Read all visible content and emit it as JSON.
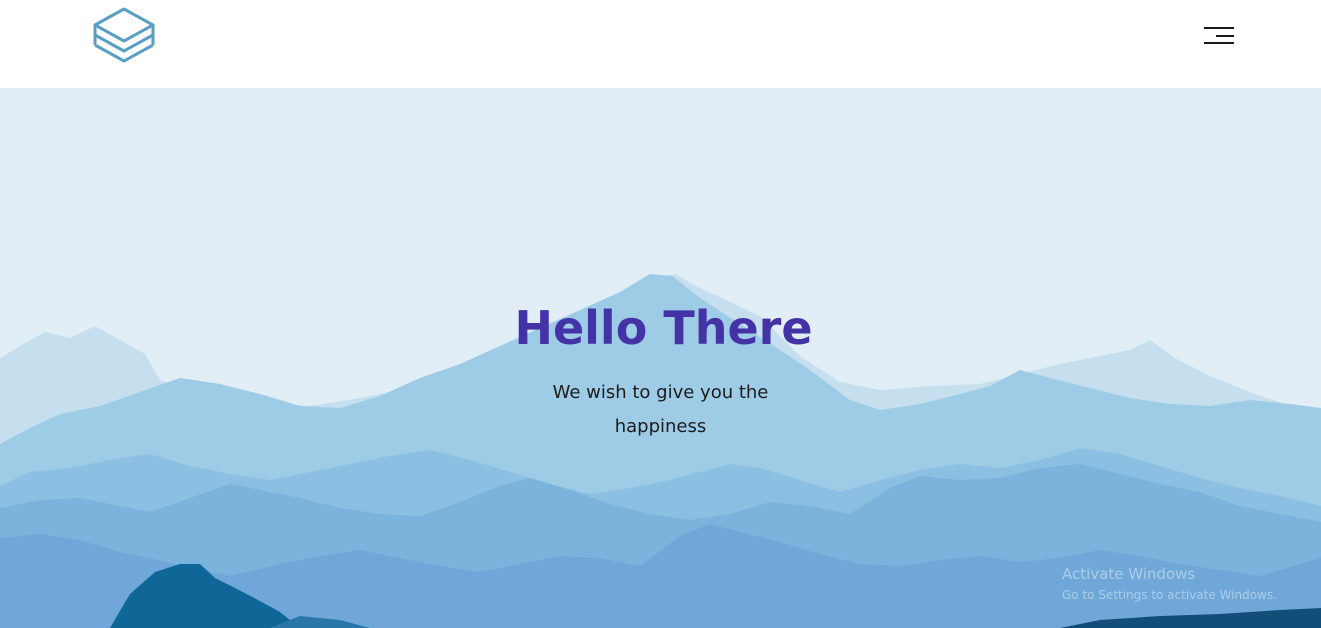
{
  "header": {
    "logo_icon": "layers-stack-icon",
    "menu_icon": "hamburger-menu-icon",
    "logo_color": "#5a9ec4"
  },
  "hero": {
    "title": "Hello There",
    "subtitle": "We wish to give you the happiness",
    "title_color": "#4433a6",
    "background_color": "#e1eef5"
  },
  "watermark": {
    "title": "Activate Windows",
    "subtitle": "Go to Settings to activate Windows."
  }
}
